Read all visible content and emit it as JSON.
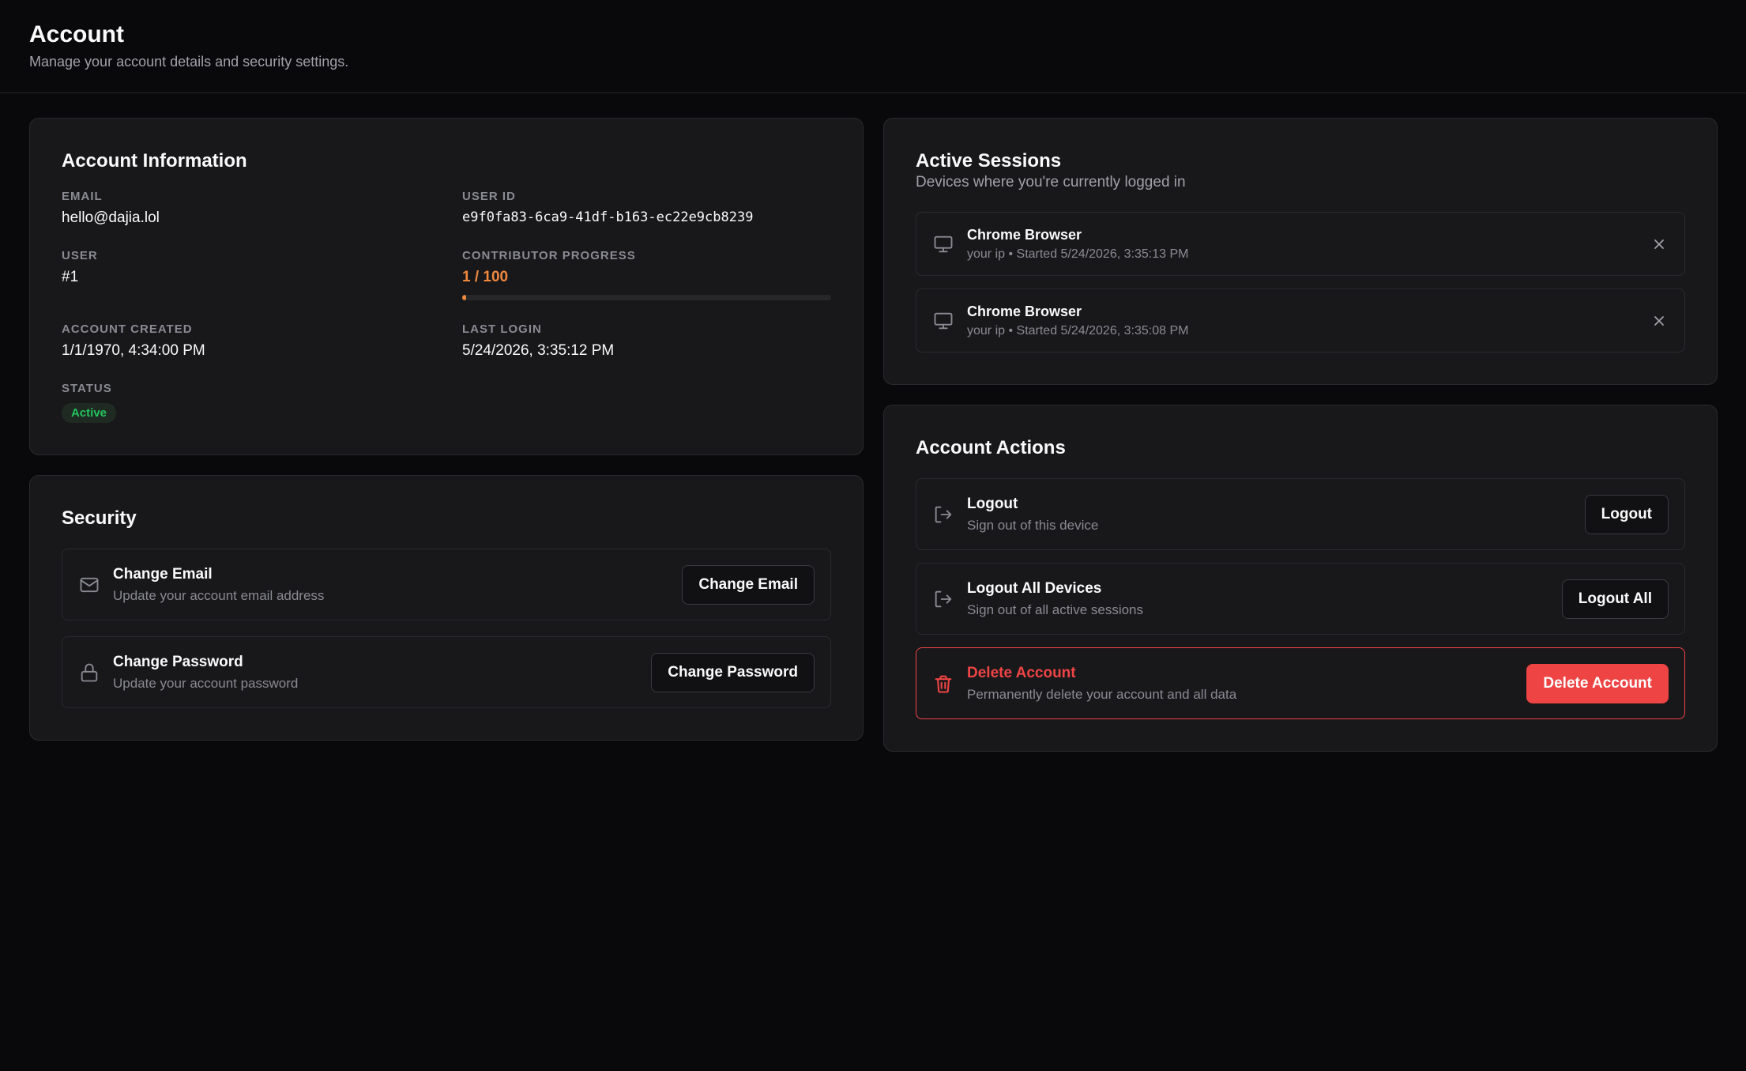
{
  "header": {
    "title": "Account",
    "subtitle": "Manage your account details and security settings."
  },
  "account_info": {
    "title": "Account Information",
    "email_label": "EMAIL",
    "email": "hello@dajia.lol",
    "user_id_label": "USER ID",
    "user_id": "e9f0fa83-6ca9-41df-b163-ec22e9cb8239",
    "user_label": "USER",
    "user": "#1",
    "progress_label": "CONTRIBUTOR PROGRESS",
    "progress_text": "1 / 100",
    "progress_fraction": 0.01,
    "created_label": "ACCOUNT CREATED",
    "created": "1/1/1970, 4:34:00 PM",
    "last_login_label": "LAST LOGIN",
    "last_login": "5/24/2026, 3:35:12 PM",
    "status_label": "STATUS",
    "status": "Active"
  },
  "security": {
    "title": "Security",
    "items": [
      {
        "icon": "mail-icon",
        "title": "Change Email",
        "subtitle": "Update your account email address",
        "button": "Change Email"
      },
      {
        "icon": "lock-icon",
        "title": "Change Password",
        "subtitle": "Update your account password",
        "button": "Change Password"
      }
    ]
  },
  "sessions": {
    "title": "Active Sessions",
    "subtitle": "Devices where you're currently logged in",
    "items": [
      {
        "icon": "monitor-icon",
        "title": "Chrome Browser",
        "subtitle": "your ip • Started 5/24/2026, 3:35:13 PM"
      },
      {
        "icon": "monitor-icon",
        "title": "Chrome Browser",
        "subtitle": "your ip • Started 5/24/2026, 3:35:08 PM"
      }
    ]
  },
  "actions": {
    "title": "Account Actions",
    "items": [
      {
        "icon": "logout-icon",
        "title": "Logout",
        "subtitle": "Sign out of this device",
        "button": "Logout"
      },
      {
        "icon": "logout-icon",
        "title": "Logout All Devices",
        "subtitle": "Sign out of all active sessions",
        "button": "Logout All"
      },
      {
        "icon": "trash-icon",
        "title": "Delete Account",
        "subtitle": "Permanently delete your account and all data",
        "button": "Delete Account"
      }
    ]
  },
  "colors": {
    "background": "#09090b",
    "card": "#18181b",
    "accent_orange": "#f0883e",
    "status_green": "#22c55e",
    "danger_red": "#ef4444"
  }
}
